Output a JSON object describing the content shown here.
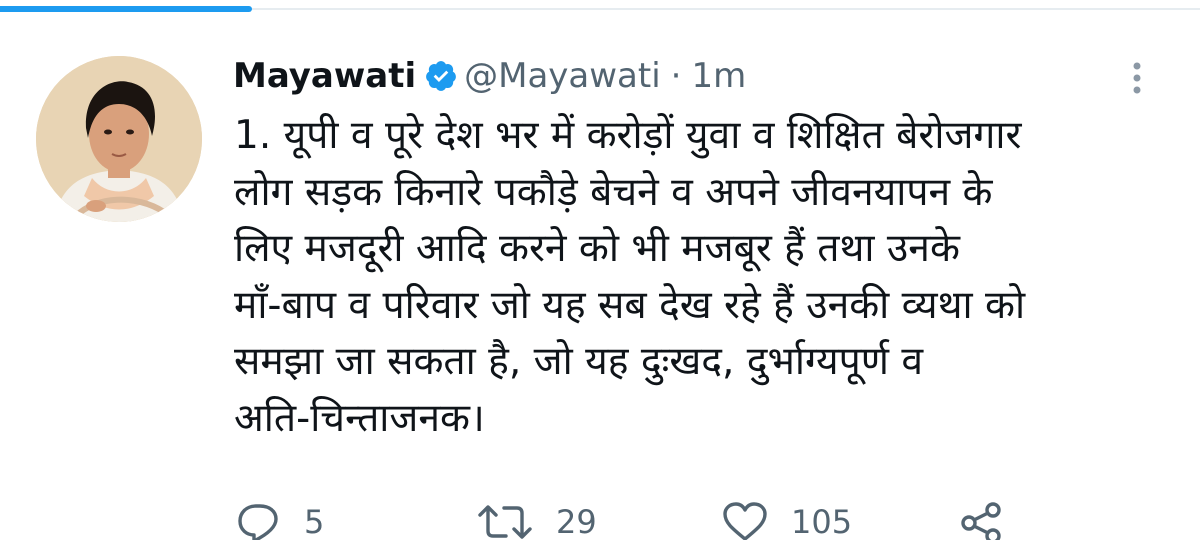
{
  "tweet": {
    "display_name": "Mayawati",
    "handle": "@Mayawati",
    "separator": "·",
    "time": "1m",
    "verified": true,
    "text": "1. यूपी व पूरे देश भर में करोड़ों युवा व शिक्षित बेरोजगार\nलोग सड़क किनारे पकौड़े बेचने व अपने जीवनयापन के\nलिए मजदूरी आदि करने को भी मजबूर हैं तथा उनके\nमाँ-बाप व परिवार जो यह सब देख रहे हैं उनकी व्यथा को\nसमझा जा सकता है, जो यह दुःखद, दुर्भाग्यपूर्ण व\nअति-चिन्ताजनक।"
  },
  "actions": {
    "reply_count": "5",
    "retweet_count": "29",
    "like_count": "105"
  },
  "icons": {
    "verified": "verified-badge-icon",
    "more": "more-vertical-icon",
    "reply": "reply-icon",
    "retweet": "retweet-icon",
    "like": "heart-icon",
    "share": "share-icon"
  },
  "colors": {
    "accent": "#1d9bf0",
    "text_primary": "#0f1419",
    "text_secondary": "#536471",
    "divider": "#e6ecf0"
  }
}
